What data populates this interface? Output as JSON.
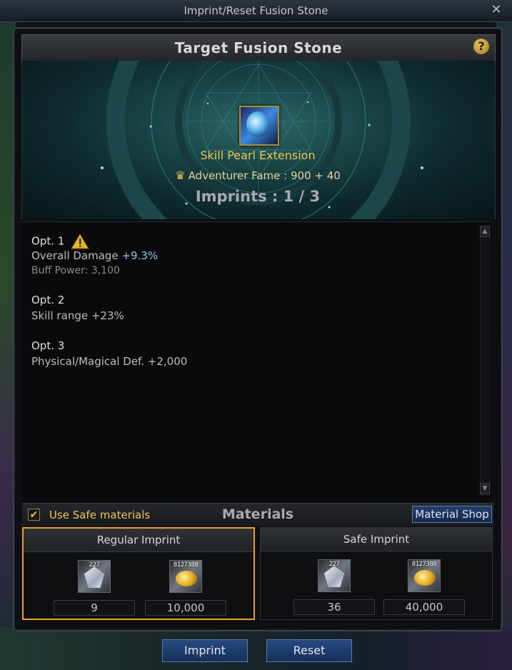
{
  "window": {
    "title": "Imprint/Reset Fusion Stone",
    "close_icon": "close-icon"
  },
  "header": {
    "title": "Target Fusion Stone",
    "help_label": "?"
  },
  "stone": {
    "name": "Skill Pearl Extension",
    "fame_label": "Adventurer Fame : 900 + 40",
    "imprints_label": "Imprints : 1 / 3"
  },
  "options": [
    {
      "title": "Opt. 1",
      "warning_icon": "warning-triangle-icon",
      "line_prefix": "Overall Damage ",
      "line_value": "+9.3%",
      "sub": "Buff Power: 3,100"
    },
    {
      "title": "Opt. 2",
      "line": "Skill range +23%"
    },
    {
      "title": "Opt. 3",
      "line": "Physical/Magical Def. +2,000"
    }
  ],
  "materials": {
    "safe_checkbox_label": "Use Safe materials",
    "safe_checked": true,
    "title": "Materials",
    "shop_label": "Material Shop"
  },
  "cards": {
    "regular": {
      "title": "Regular Imprint",
      "item1_badge": "227",
      "item2_badge": "8127388",
      "qty1": "9",
      "qty2": "10,000"
    },
    "safe": {
      "title": "Safe Imprint",
      "item1_badge": "227",
      "item2_badge": "8127388",
      "qty1": "36",
      "qty2": "40,000"
    }
  },
  "actions": {
    "imprint_label": "Imprint",
    "reset_label": "Reset"
  },
  "colors": {
    "accent_gold": "#f0c850",
    "selected_border": "#f0a020",
    "highlight_blue": "#8cc8f0"
  }
}
